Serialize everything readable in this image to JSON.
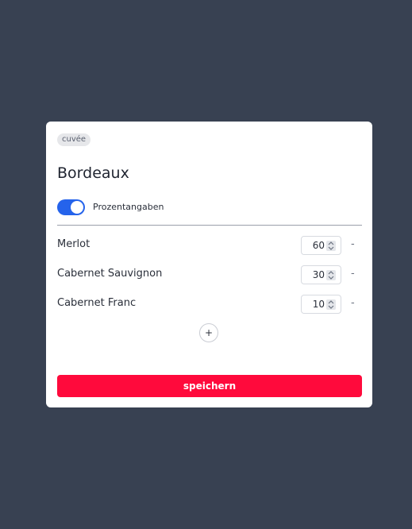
{
  "card": {
    "tag": "cuvée",
    "title": "Bordeaux",
    "toggle": {
      "label": "Prozentangaben",
      "on": true
    },
    "grapes": [
      {
        "name": "Merlot",
        "value": "60",
        "remove": "-"
      },
      {
        "name": "Cabernet Sauvignon",
        "value": "30",
        "remove": "-"
      },
      {
        "name": "Cabernet Franc",
        "value": "10",
        "remove": "-"
      }
    ],
    "add_label": "+",
    "save_label": "speichern"
  },
  "colors": {
    "background": "#384152",
    "toggle_on": "#2563eb",
    "save_button": "#ff0a3c"
  },
  "icons": [
    "spinner-icon",
    "plus-icon",
    "minus-icon"
  ]
}
